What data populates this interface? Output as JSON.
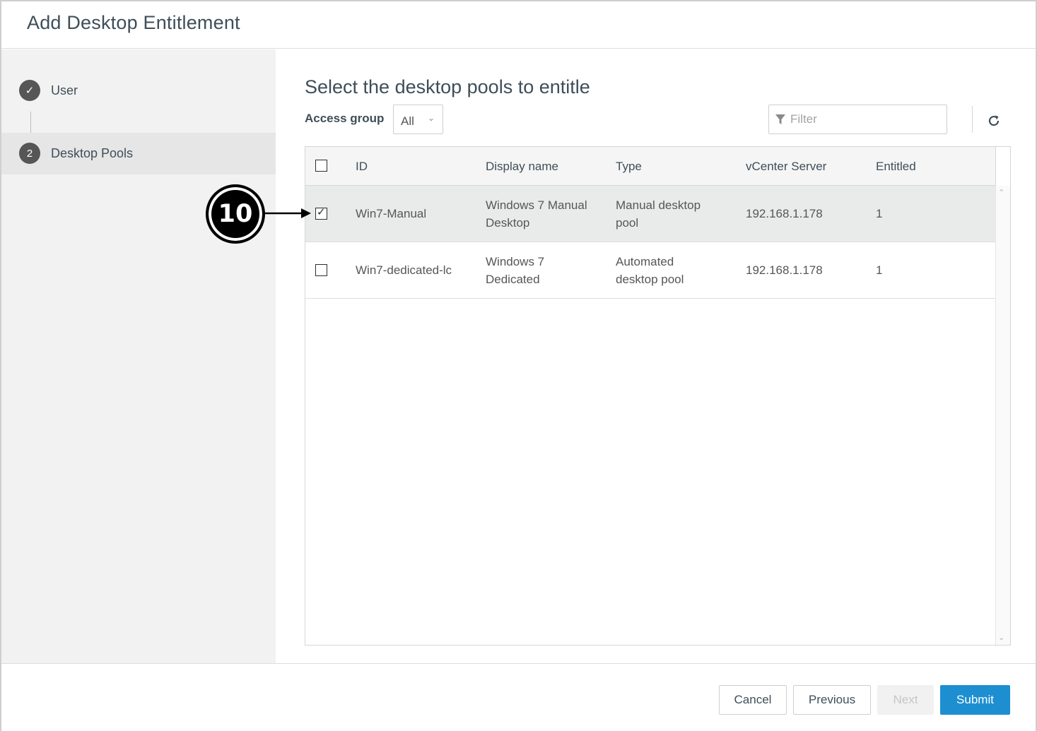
{
  "dialog": {
    "title": "Add Desktop Entitlement"
  },
  "sidebar": {
    "steps": [
      {
        "marker": "✓",
        "label": "User"
      },
      {
        "marker": "2",
        "label": "Desktop Pools"
      }
    ]
  },
  "main": {
    "heading": "Select the desktop pools to entitle",
    "access_group": {
      "label": "Access group",
      "value": "All"
    },
    "filter": {
      "placeholder": "Filter",
      "value": ""
    },
    "refresh_icon": "refresh-icon"
  },
  "table": {
    "columns": [
      "ID",
      "Display name",
      "Type",
      "vCenter Server",
      "Entitled"
    ],
    "rows": [
      {
        "checked": true,
        "id": "Win7-Manual",
        "display_name": [
          "Windows 7 Manual",
          "Desktop"
        ],
        "type": [
          "Manual desktop",
          "pool"
        ],
        "vcenter": "192.168.1.178",
        "entitled": "1"
      },
      {
        "checked": false,
        "id": "Win7-dedicated-lc",
        "display_name": [
          "Windows 7",
          "Dedicated"
        ],
        "type": [
          "Automated",
          "desktop pool"
        ],
        "vcenter": "192.168.1.178",
        "entitled": "1"
      }
    ]
  },
  "footer": {
    "cancel_label": "Cancel",
    "previous_label": "Previous",
    "next_label": "Next",
    "submit_label": "Submit"
  },
  "annotation": {
    "callout_number": "10"
  },
  "colors": {
    "accent": "#1d8fd1",
    "selected_row": "#e9ebeb",
    "sidebar": "#f2f2f2"
  }
}
